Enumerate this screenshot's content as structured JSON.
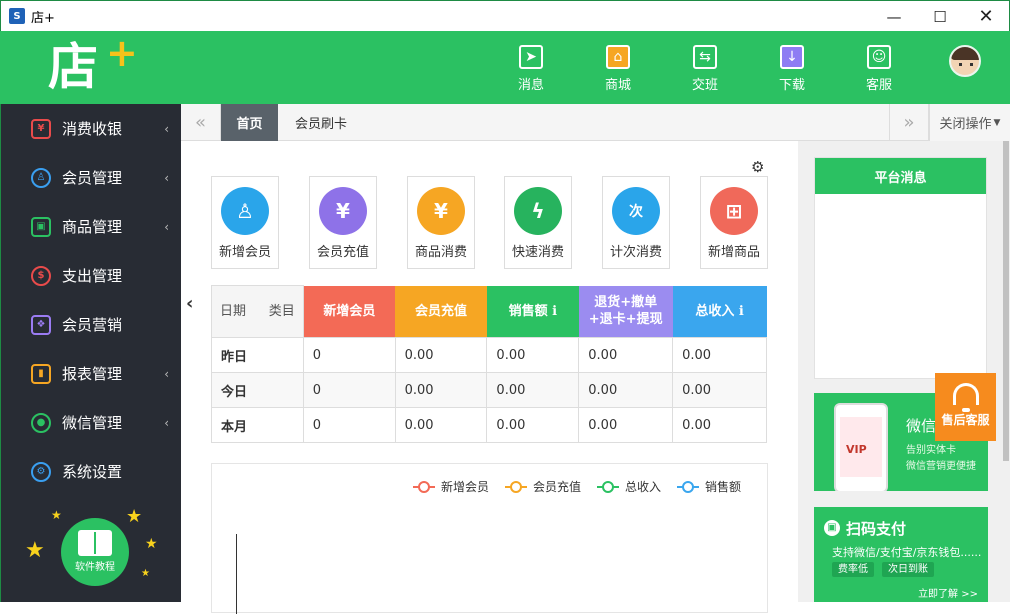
{
  "window": {
    "title": "店+",
    "app_icon": "shop-app-icon"
  },
  "header": {
    "logo_text": "店",
    "logo_plus": "+",
    "nav": [
      {
        "label": "消息",
        "icon": "message-plane-icon",
        "color": "#2bc162"
      },
      {
        "label": "商城",
        "icon": "mall-icon",
        "color": "#f6a623"
      },
      {
        "label": "交班",
        "icon": "shift-swap-icon",
        "color": "#2bc162"
      },
      {
        "label": "下载",
        "icon": "download-icon",
        "color": "#8e7cf3"
      },
      {
        "label": "客服",
        "icon": "customer-service-icon",
        "color": "#2bc162"
      }
    ]
  },
  "sidebar": {
    "items": [
      {
        "label": "消费收银",
        "icon": "cashier-icon",
        "color": "#e94b4b",
        "chevron": "‹"
      },
      {
        "label": "会员管理",
        "icon": "members-icon",
        "color": "#3a9ff0",
        "chevron": "‹"
      },
      {
        "label": "商品管理",
        "icon": "goods-icon",
        "color": "#2bc162",
        "chevron": "‹"
      },
      {
        "label": "支出管理",
        "icon": "expense-icon",
        "color": "#e94b4b",
        "chevron": ""
      },
      {
        "label": "会员营销",
        "icon": "gift-icon",
        "color": "#9b7cf3",
        "chevron": ""
      },
      {
        "label": "报表管理",
        "icon": "report-icon",
        "color": "#f6a623",
        "chevron": "‹"
      },
      {
        "label": "微信管理",
        "icon": "wechat-icon",
        "color": "#2bc162",
        "chevron": "‹"
      },
      {
        "label": "系统设置",
        "icon": "settings-icon",
        "color": "#3a9ff0",
        "chevron": ""
      }
    ],
    "tutorial_label": "软件教程"
  },
  "tabs": {
    "items": [
      "首页",
      "会员刷卡"
    ],
    "active": "首页",
    "close_ops": "关闭操作"
  },
  "quick_actions": [
    {
      "label": "新增会员",
      "icon": "add-member-icon",
      "color": "#2aa5ea",
      "glyph": "♙"
    },
    {
      "label": "会员充值",
      "icon": "recharge-icon",
      "color": "#8e72e8",
      "glyph": "¥"
    },
    {
      "label": "商品消费",
      "icon": "goods-consume-icon",
      "color": "#f6a623",
      "glyph": "¥"
    },
    {
      "label": "快速消费",
      "icon": "quick-consume-icon",
      "color": "#27b35e",
      "glyph": "ϟ"
    },
    {
      "label": "计次消费",
      "icon": "count-consume-icon",
      "color": "#2aa5ea",
      "glyph": "次"
    },
    {
      "label": "新增商品",
      "icon": "add-goods-icon",
      "color": "#f0695a",
      "glyph": "⊞"
    }
  ],
  "stats": {
    "corner_row": "日期",
    "corner_col": "类目",
    "columns": [
      {
        "label": "新增会员",
        "color": "#f36a56"
      },
      {
        "label": "会员充值",
        "color": "#f6a623"
      },
      {
        "label": "销售额 ℹ",
        "color": "#2bc162"
      },
      {
        "label": "退货+撤单\n+退卡+提现",
        "color": "#9b8cf0"
      },
      {
        "label": "总收入 ℹ",
        "color": "#3aa6ee"
      }
    ],
    "rows": [
      {
        "label": "昨日",
        "values": [
          "0",
          "0.00",
          "0.00",
          "0.00",
          "0.00"
        ]
      },
      {
        "label": "今日",
        "values": [
          "0",
          "0.00",
          "0.00",
          "0.00",
          "0.00"
        ]
      },
      {
        "label": "本月",
        "values": [
          "0",
          "0.00",
          "0.00",
          "0.00",
          "0.00"
        ]
      }
    ]
  },
  "chart_legend": [
    {
      "label": "新增会员",
      "color": "#f36a56"
    },
    {
      "label": "会员充值",
      "color": "#f6a623"
    },
    {
      "label": "总收入",
      "color": "#2bc162"
    },
    {
      "label": "销售额",
      "color": "#3aa6ee"
    }
  ],
  "right_panel": {
    "messages_title": "平台消息",
    "banner1": {
      "title": "微信",
      "line1": "告别实体卡",
      "line2": "微信营销更便捷",
      "phone_text": "VIP"
    },
    "service_label": "售后客服",
    "banner2": {
      "title": "扫码支付",
      "desc": "支持微信/支付宝/京东钱包......",
      "chip1": "费率低",
      "chip2": "次日到账",
      "more": "立即了解 >>"
    }
  },
  "colors": {
    "brand_green": "#2bc162",
    "sidebar_bg": "#282c34",
    "accent_orange": "#f68b1e"
  }
}
